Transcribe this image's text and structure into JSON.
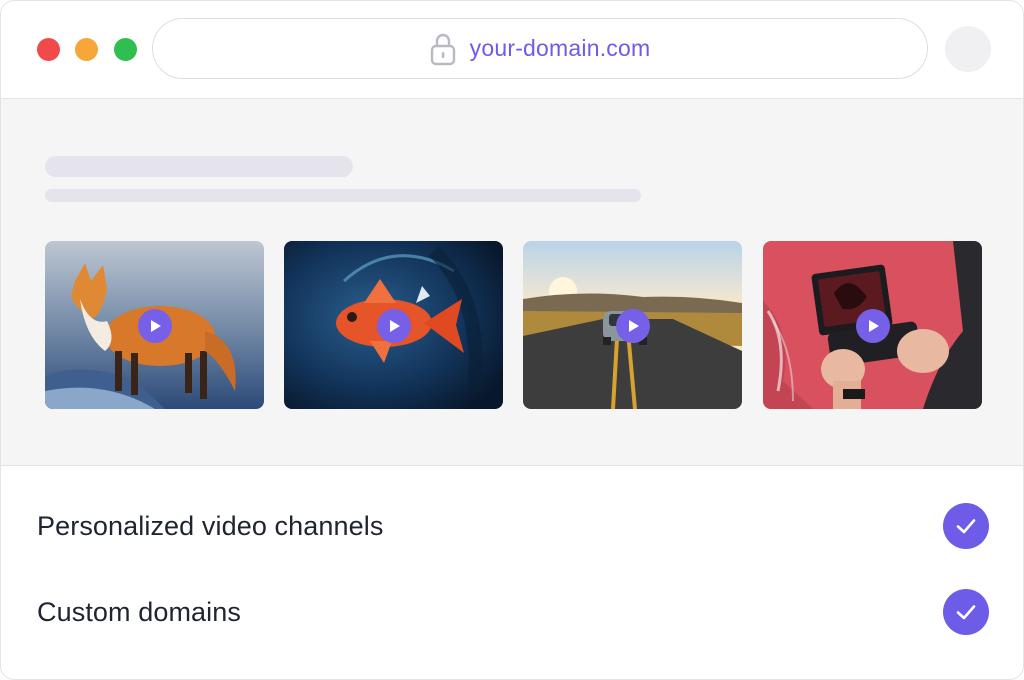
{
  "browser": {
    "address": "your-domain.com",
    "accent_color": "#6c5ce7",
    "traffic_lights": [
      "#f04a4a",
      "#f7a63a",
      "#2fbe4f"
    ]
  },
  "videos": [
    {
      "subject": "fox",
      "icon": "play-icon"
    },
    {
      "subject": "fish",
      "icon": "play-icon"
    },
    {
      "subject": "car-on-road",
      "icon": "play-icon"
    },
    {
      "subject": "handheld-gaming-pc",
      "icon": "play-icon"
    }
  ],
  "features": [
    {
      "label": "Personalized video channels",
      "icon": "check-icon",
      "checked": true
    },
    {
      "label": "Custom domains",
      "icon": "check-icon",
      "checked": true
    }
  ]
}
